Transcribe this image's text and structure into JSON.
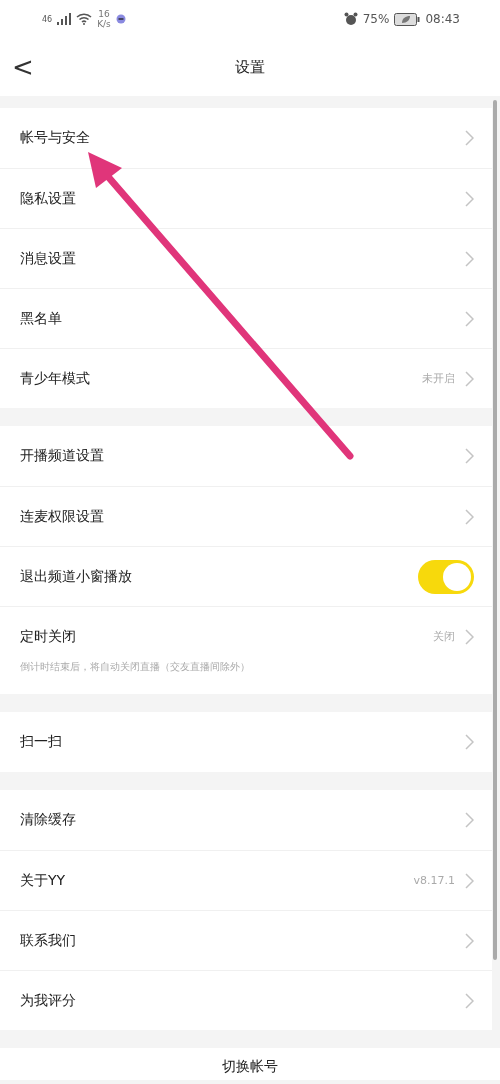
{
  "status_bar": {
    "network": "46",
    "speed": "16",
    "speed_unit": "K/s",
    "battery": "75%",
    "time": "08:43"
  },
  "header": {
    "back": "<",
    "title": "设置"
  },
  "sections": [
    {
      "items": [
        {
          "kind": "link",
          "label": "帐号与安全"
        },
        {
          "kind": "link",
          "label": "隐私设置"
        },
        {
          "kind": "link",
          "label": "消息设置"
        },
        {
          "kind": "link",
          "label": "黑名单"
        },
        {
          "kind": "link",
          "label": "青少年模式",
          "value": "未开启"
        }
      ]
    },
    {
      "items": [
        {
          "kind": "link",
          "label": "开播频道设置"
        },
        {
          "kind": "link",
          "label": "连麦权限设置"
        },
        {
          "kind": "toggle",
          "label": "退出频道小窗播放",
          "on": true
        },
        {
          "kind": "link",
          "label": "定时关闭",
          "value": "关闭"
        }
      ],
      "note": "倒计时结束后，将自动关闭直播（交友直播间除外）"
    },
    {
      "items": [
        {
          "kind": "link",
          "label": "扫一扫"
        }
      ]
    },
    {
      "items": [
        {
          "kind": "link",
          "label": "清除缓存"
        },
        {
          "kind": "link",
          "label": "关于YY",
          "value": "v8.17.1"
        },
        {
          "kind": "link",
          "label": "联系我们"
        },
        {
          "kind": "link",
          "label": "为我评分"
        }
      ]
    }
  ],
  "switch_account": "切换帐号"
}
